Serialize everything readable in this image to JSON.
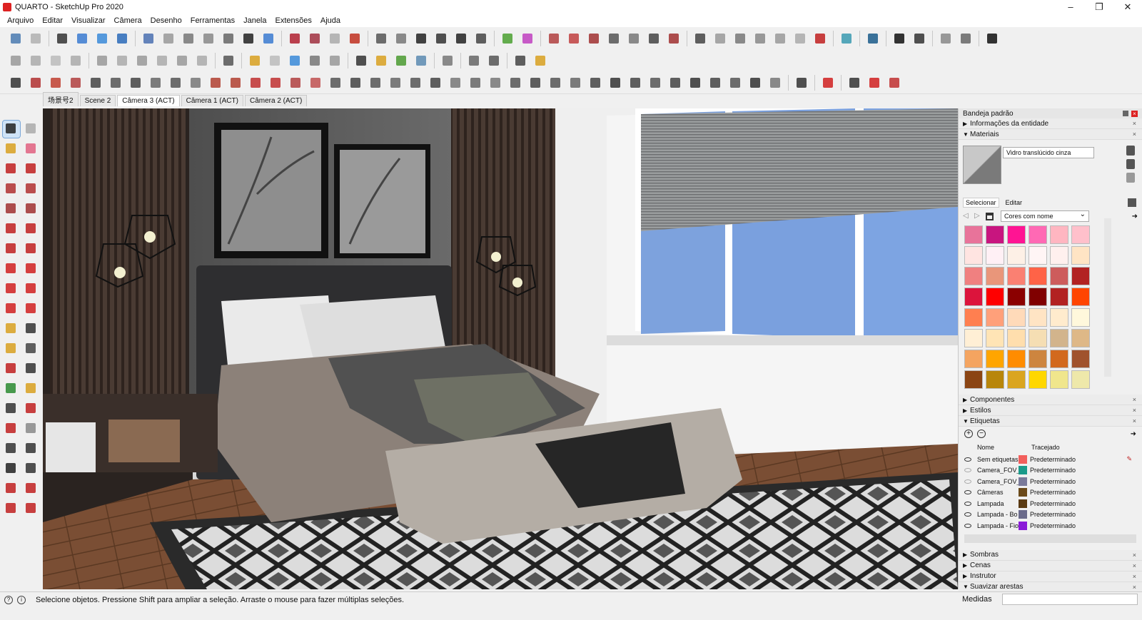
{
  "window": {
    "title": "QUARTO - SketchUp Pro 2020",
    "min": "–",
    "max": "❐",
    "close": "✕"
  },
  "menu": [
    "Arquivo",
    "Editar",
    "Visualizar",
    "Câmera",
    "Desenho",
    "Ferramentas",
    "Janela",
    "Extensões",
    "Ajuda"
  ],
  "scenes": [
    "场景号2",
    "Scene 2",
    "Câmera 3 (ACT)",
    "Câmera 1 (ACT)",
    "Câmera 2 (ACT)"
  ],
  "active_scene": 2,
  "tray": {
    "title": "Bandeja padrão",
    "panels": {
      "entity_info": "Informações da entidade",
      "materials": "Materiais",
      "components": "Componentes",
      "styles": "Estilos",
      "tags": "Etiquetas",
      "shadows": "Sombras",
      "scenes": "Cenas",
      "instructor": "Instrutor",
      "soften_edges": "Suavizar arestas"
    },
    "material_name": "Vidro translúcido cinza",
    "tabs": {
      "select": "Selecionar",
      "edit": "Editar"
    },
    "library": "Cores com nome",
    "palette": [
      "#e8739a",
      "#c8157f",
      "#ff1493",
      "#ff69b4",
      "#ffb6c1",
      "#ffc0cb",
      "#ffe4e1",
      "#fff0f5",
      "#fdf0e6",
      "#fff5f5",
      "#fff0ee",
      "#ffe4c4",
      "#f08080",
      "#e9967a",
      "#fa8072",
      "#ff6347",
      "#cd5c5c",
      "#b22222",
      "#dc143c",
      "#ff0000",
      "#8b0000",
      "#800000",
      "#b22222",
      "#ff4500",
      "#ff7f50",
      "#ffa07a",
      "#ffdab9",
      "#ffe4c4",
      "#ffebcd",
      "#fff8dc",
      "#ffefd5",
      "#ffe4b5",
      "#ffdead",
      "#f5deb3",
      "#d2b48c",
      "#deb887",
      "#f4a460",
      "#ffa500",
      "#ff8c00",
      "#cd853f",
      "#d2691e",
      "#a0522d",
      "#8b4513",
      "#b8860b",
      "#daa520",
      "#ffd700",
      "#f0e68c",
      "#eee8aa"
    ],
    "tags_header": {
      "name": "Nome",
      "line": "Tracejado"
    },
    "tags": [
      {
        "name": "Sem etiquetas",
        "color": "#f25f5c",
        "line": "Predeterminado",
        "visible": true
      },
      {
        "name": "Camera_FOV_",
        "color": "#1a9a8a",
        "line": "Predeterminado",
        "visible": false
      },
      {
        "name": "Camera_FOV_",
        "color": "#7a7a9a",
        "line": "Predeterminado",
        "visible": false
      },
      {
        "name": "Câmeras",
        "color": "#6b4a1a",
        "line": "Predeterminado",
        "visible": true
      },
      {
        "name": "Lampada",
        "color": "#5a3a12",
        "line": "Predeterminado",
        "visible": true
      },
      {
        "name": "Lampada - Bo",
        "color": "#6a6a8a",
        "line": "Predeterminado",
        "visible": true
      },
      {
        "name": "Lampada - Fio",
        "color": "#8a1ad8",
        "line": "Predeterminado",
        "visible": true
      }
    ]
  },
  "status": {
    "message": "Selecione objetos. Pressione Shift para ampliar a seleção. Arraste o mouse para fazer múltiplas seleções.",
    "measures_label": "Medidas",
    "measures_value": ""
  }
}
